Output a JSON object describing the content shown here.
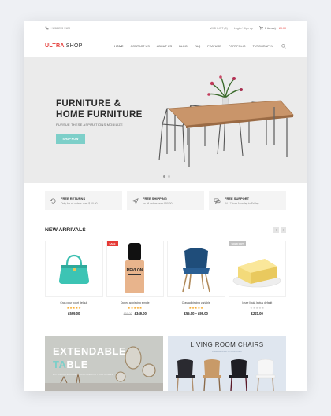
{
  "topbar": {
    "phone": "+1 38 233 9120",
    "wishlist": "WISHLIST (0)",
    "login": "Login / Sign up",
    "cart_label": "0 item(s) - ",
    "cart_amount": "£0.00"
  },
  "brand": {
    "part1": "ULTRA",
    "part2": "SHOP"
  },
  "nav": [
    "HOME",
    "CONTACT US",
    "ABOUT US",
    "BLOG",
    "FAQ",
    "FEATURE",
    "PORTFOLIO",
    "TYPOGRAPHY"
  ],
  "hero": {
    "title_line1": "FURNITURE &",
    "title_line2": "HOME FURNITURE",
    "subtitle": "PURSUE THESE ASPIRATIONS MOBILIZE",
    "cta": "SHOP NOW",
    "slides": 2,
    "active_slide": 1
  },
  "features": [
    {
      "icon": "return-icon",
      "title": "FREE RETURNS",
      "subtitle": "Only for all orders over $ 10.00"
    },
    {
      "icon": "plane-icon",
      "title": "FREE SHIPPING",
      "subtitle": "on all orders over $50.00"
    },
    {
      "icon": "chat-icon",
      "title": "FREE SUPPORT",
      "subtitle": "24 / 7 from Monday to Friday"
    }
  ],
  "arrivals": {
    "heading": "NEW ARRIVALS",
    "prev": "‹",
    "next": "›",
    "products": [
      {
        "name": "Cras pour pourt default",
        "stars": "★★★★★",
        "old_price": "",
        "price": "£599.00",
        "badge": ""
      },
      {
        "name": "Donec adipiscing simple",
        "stars": "★★★★★",
        "old_price": "£59.00",
        "price": "£349.00",
        "badge": "SALE"
      },
      {
        "name": "Cras adipiscing variable",
        "stars": "★★★★★",
        "old_price": "",
        "price": "£55.00 – £99.00",
        "badge": ""
      },
      {
        "name": "Iosse ligula lectus default",
        "stars": "★★★★★",
        "old_price": "",
        "price": "£221.00",
        "badge": "SOLD OUT"
      }
    ],
    "revlon_text": "REVLON"
  },
  "banners": {
    "left": {
      "line1": "EXTENDABLE",
      "line2_pre": "TA",
      "line2_post": "BLE",
      "sub": "EXTENDABLE HOME FURNITURE FOR YOUR HOMES"
    },
    "right": {
      "title": "LIVING ROOM CHAIRS",
      "sub": "EXPERIENCE IN THE CITY"
    }
  },
  "colors": {
    "accent": "#e53935",
    "teal": "#7dcfc9",
    "star": "#f5a623"
  }
}
